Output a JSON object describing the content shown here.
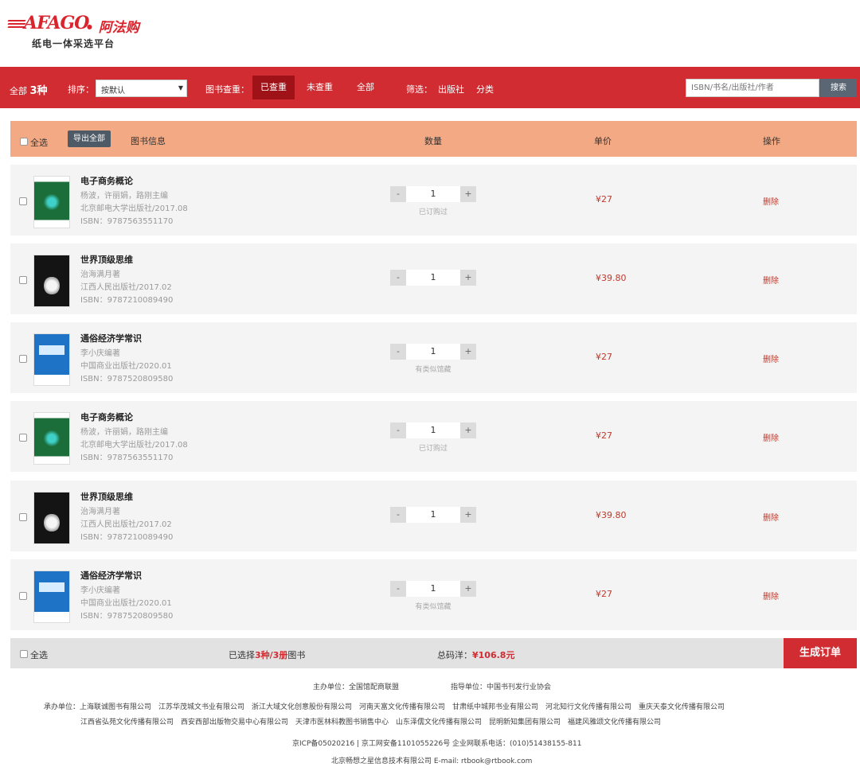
{
  "brand": {
    "logo_text": "AFAGO",
    "logo_cn": "• 阿法购",
    "tagline": "纸电一体采选平台"
  },
  "filter_bar": {
    "total_label": "全部",
    "total_count": "3种",
    "sort_label": "排序：",
    "sort_selected": "按默认",
    "dedupe_label": "图书查重：",
    "tabs": [
      {
        "label": "已查重",
        "active": true
      },
      {
        "label": "未查重",
        "active": false
      },
      {
        "label": "全部",
        "active": false
      }
    ],
    "filter_label": "筛选：",
    "filter_links": [
      "出版社",
      "分类"
    ],
    "search_placeholder": "ISBN/书名/出版社/作者",
    "search_button": "搜索"
  },
  "table_header": {
    "select_all": "全选",
    "export_button": "导出全部",
    "columns": {
      "info": "图书信息",
      "quantity": "数量",
      "price": "单价",
      "action": "操作"
    }
  },
  "books": [
    {
      "title": "电子商务概论",
      "authors": "杨波，许丽娟，路刚主编",
      "publisher": "北京邮电大学出版社/2017.08",
      "isbn": "ISBN：9787563551170",
      "quantity": "1",
      "note": "已订购过",
      "price": "¥27",
      "action": "删除",
      "cover": "green"
    },
    {
      "title": "世界顶级思维",
      "authors": "治海满月著",
      "publisher": "江西人民出版社/2017.02",
      "isbn": "ISBN：9787210089490",
      "quantity": "1",
      "note": "",
      "price": "¥39.80",
      "action": "删除",
      "cover": "dark"
    },
    {
      "title": "通俗经济学常识",
      "authors": "李小庆编著",
      "publisher": "中国商业出版社/2020.01",
      "isbn": "ISBN：9787520809580",
      "quantity": "1",
      "note": "有类似馆藏",
      "price": "¥27",
      "action": "删除",
      "cover": "blue"
    },
    {
      "title": "电子商务概论",
      "authors": "杨波，许丽娟，路刚主编",
      "publisher": "北京邮电大学出版社/2017.08",
      "isbn": "ISBN：9787563551170",
      "quantity": "1",
      "note": "已订购过",
      "price": "¥27",
      "action": "删除",
      "cover": "green"
    },
    {
      "title": "世界顶级思维",
      "authors": "治海满月著",
      "publisher": "江西人民出版社/2017.02",
      "isbn": "ISBN：9787210089490",
      "quantity": "1",
      "note": "",
      "price": "¥39.80",
      "action": "删除",
      "cover": "dark"
    },
    {
      "title": "通俗经济学常识",
      "authors": "李小庆编著",
      "publisher": "中国商业出版社/2020.01",
      "isbn": "ISBN：9787520809580",
      "quantity": "1",
      "note": "有类似馆藏",
      "price": "¥27",
      "action": "删除",
      "cover": "blue"
    }
  ],
  "summary": {
    "select_all": "全选",
    "selected_prefix": "已选择",
    "selected_value": "3种/3册",
    "selected_suffix": "图书",
    "total_label": "总码洋：",
    "total_value": "¥106.8元",
    "submit_button": "生成订单"
  },
  "site_footer": {
    "host": "主办单位：全国馆配商联盟",
    "guide": "指导单位：中国书刊发行业协会",
    "organizers_1": "承办单位：上海联诚图书有限公司　江苏华茂城文书业有限公司　浙江大域文化创意股份有限公司　河南天富文化传播有限公司　甘肃纸中城邦书业有限公司　河北知行文化传播有限公司　重庆天泰文化传播有限公司",
    "organizers_2": "江西省弘苑文化传播有限公司　西安西部出版物交易中心有限公司　天津市医林科教图书销售中心　山东泽儒文化传播有限公司　昆明新知集团有限公司　福建风雅颂文化传播有限公司",
    "icp": "京ICP备05020216 | 京工网安备1101055226号 企业网联系电话：(010)51438155-811",
    "company": "北京畅想之星信息技术有限公司 E-mail: rtbook@rtbook.com"
  }
}
